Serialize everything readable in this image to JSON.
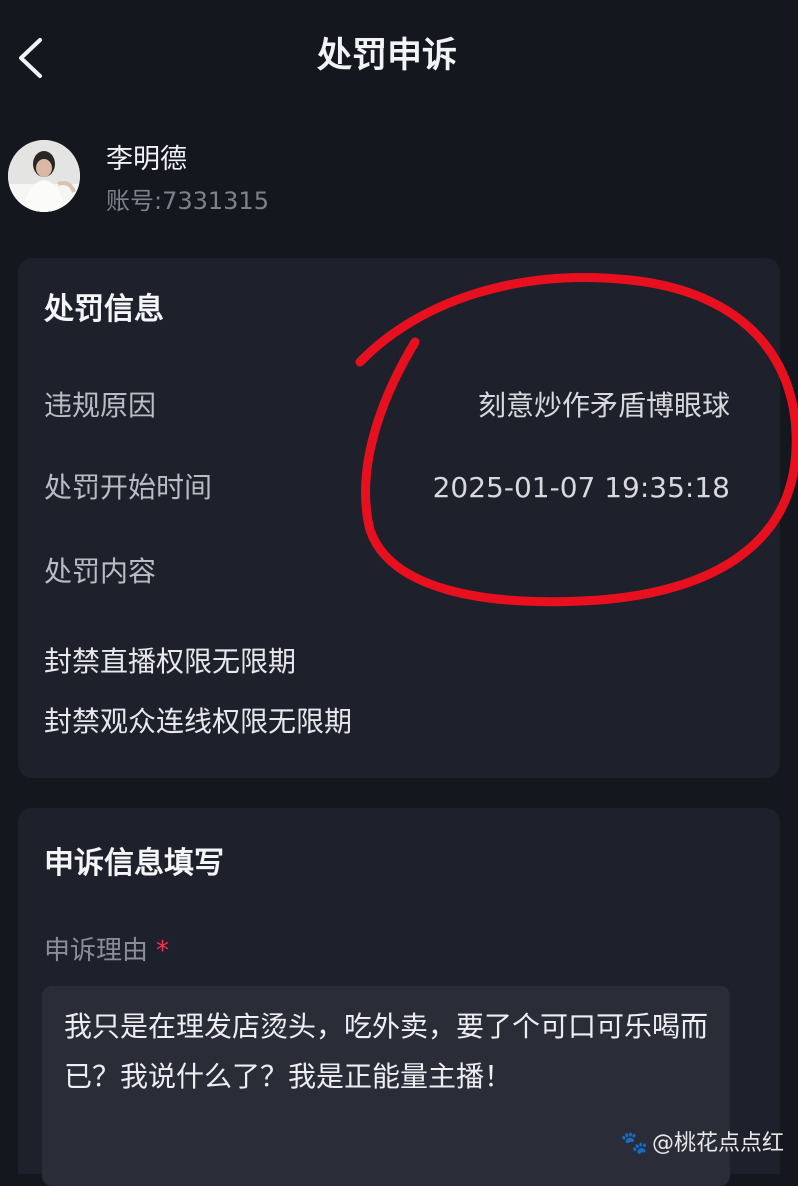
{
  "header": {
    "title": "处罚申诉",
    "back_icon": "chevron-left-icon"
  },
  "user": {
    "name": "李明德",
    "account": "账号:7331315"
  },
  "punishment": {
    "section_title": "处罚信息",
    "rows": [
      {
        "label": "违规原因",
        "value": "刻意炒作矛盾博眼球"
      },
      {
        "label": "处罚开始时间",
        "value": "2025-01-07 19:35:18"
      },
      {
        "label": "处罚内容",
        "value": ""
      }
    ],
    "content_items": [
      "封禁直播权限无限期",
      "封禁观众连线权限无限期"
    ]
  },
  "appeal": {
    "section_title": "申诉信息填写",
    "reason_label": "申诉理由",
    "required_mark": "*",
    "reason_text": "我只是在理发店烫头，吃外卖，要了个可口可乐喝而已？我说什么了？我是正能量主播！"
  },
  "watermark": {
    "text": "@桃花点点红",
    "icon": "paw-icon"
  },
  "colors": {
    "background": "#15171f",
    "card": "#1e212b",
    "annotation_circle": "#e8101e",
    "required": "#ff2d55"
  }
}
